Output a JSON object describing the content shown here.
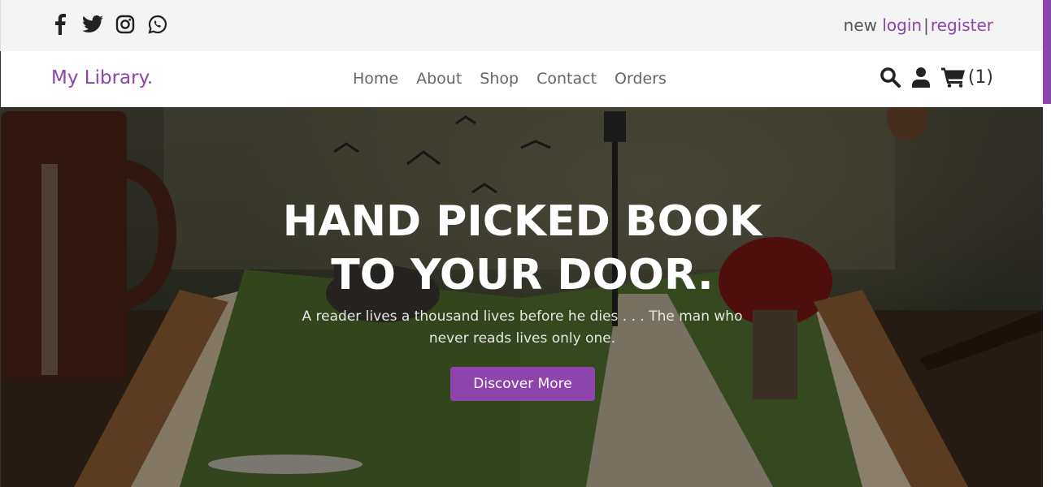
{
  "topbar": {
    "social_icons": [
      "facebook-icon",
      "twitter-icon",
      "instagram-icon",
      "whatsapp-icon"
    ],
    "auth": {
      "prefix": "new",
      "login_label": "login",
      "separator": "|",
      "register_label": "register"
    }
  },
  "navbar": {
    "logo": "My Library.",
    "links": [
      "Home",
      "About",
      "Shop",
      "Contact",
      "Orders"
    ],
    "icons": [
      "search-icon",
      "user-icon",
      "cart-icon"
    ],
    "cart_count": "(1)"
  },
  "hero": {
    "title_line1": "HAND PICKED BOOK",
    "title_line2": "TO YOUR DOOR.",
    "subtitle": "A reader lives a thousand lives before he dies . . . The man who never reads lives only one.",
    "button_label": "Discover More"
  },
  "colors": {
    "accent": "#8e44ad",
    "topbar_bg": "#f4f4f4",
    "text_dark": "#333333",
    "nav_text": "#666666"
  }
}
